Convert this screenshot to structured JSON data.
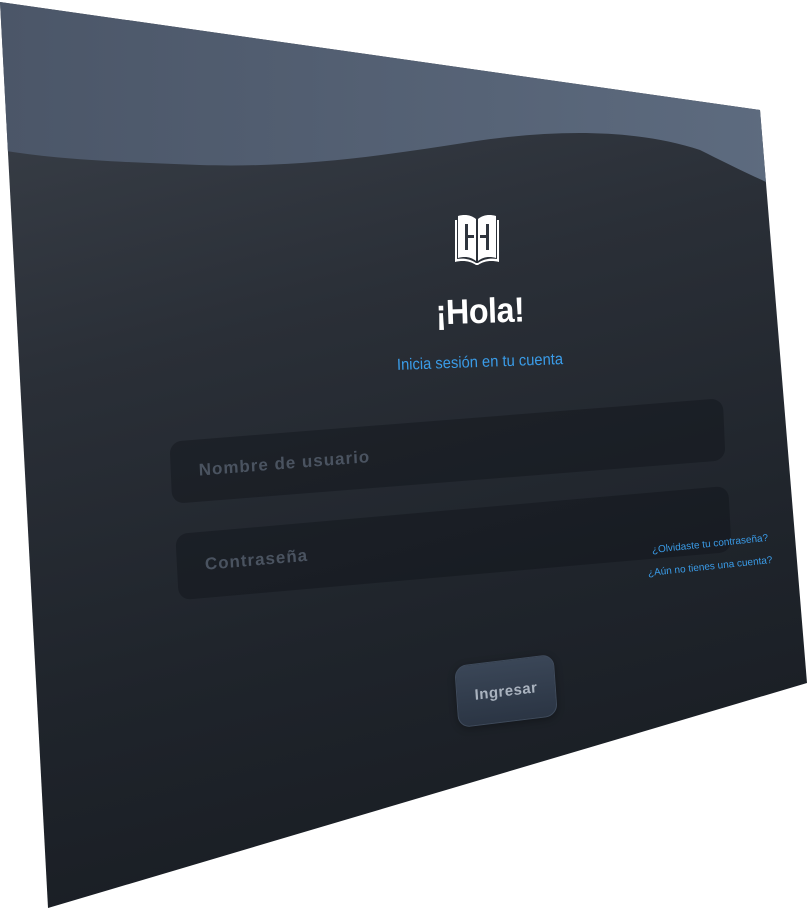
{
  "header": {
    "logo_icon": "book-h-logo-icon",
    "title": "¡Hola!",
    "subtitle": "Inicia sesión en tu cuenta"
  },
  "form": {
    "username_placeholder": "Nombre de usuario",
    "username_value": "",
    "password_placeholder": "Contraseña",
    "password_value": "",
    "forgot_password_label": "¿Olvidaste tu contraseña?",
    "signup_label": "¿Aún no tienes una cuenta?",
    "submit_label": "Ingresar"
  },
  "colors": {
    "accent": "#3a9ce8",
    "background_top": "#5d6b7e",
    "background": "#1f242b",
    "title": "#ffffff"
  }
}
